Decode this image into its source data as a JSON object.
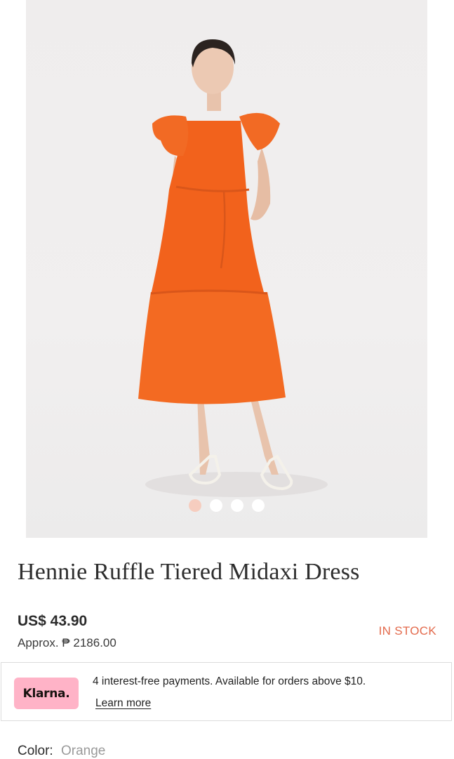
{
  "product": {
    "title": "Hennie Ruffle Tiered Midaxi Dress",
    "price": "US$ 43.90",
    "approx_price": "Approx. ₱ 2186.00",
    "stock_status": "IN STOCK"
  },
  "gallery": {
    "image_count": 4,
    "active_index": 0,
    "active_dot_color": "#f6cdbf",
    "dress_color": "#f2621c"
  },
  "klarna": {
    "logo": "Klarna.",
    "message": "4 interest-free payments. Available for orders above $10.",
    "link_label": "Learn more",
    "badge_color": "#ffb3c7"
  },
  "options": {
    "color_label": "Color:",
    "color_value": "Orange"
  },
  "colors": {
    "stock_accent": "#e36a4c"
  }
}
